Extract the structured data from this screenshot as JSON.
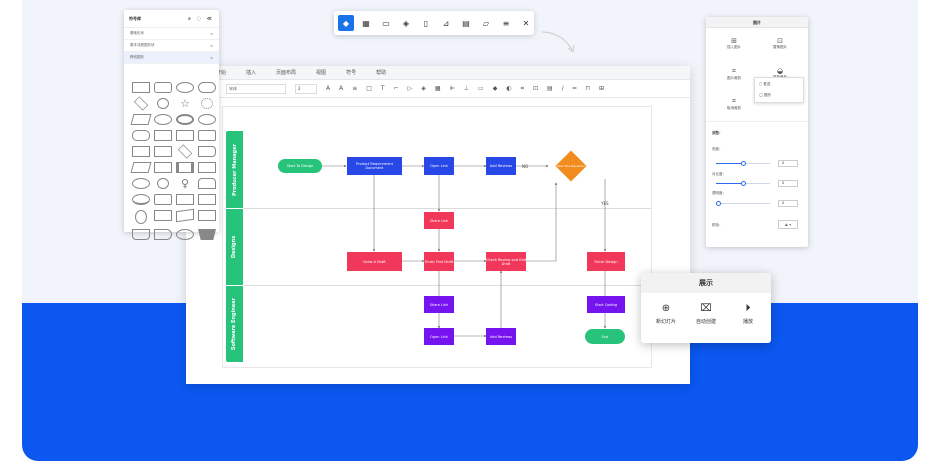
{
  "floating_toolbar": {
    "buttons": [
      "fill-icon",
      "grid-icon",
      "image-icon",
      "layers-icon",
      "page-icon",
      "chart-icon",
      "table-icon",
      "note-icon",
      "list-icon",
      "expand-icon"
    ]
  },
  "shapes_panel": {
    "title": "符号库",
    "libraries": [
      "基础形状",
      "基本流程图形状",
      "跨线图形"
    ],
    "close": "×"
  },
  "editor": {
    "menu": [
      "开始",
      "插入",
      "页面布局",
      "视图",
      "符号",
      "帮助"
    ],
    "font_name": "宋体",
    "font_size": "2"
  },
  "flowchart": {
    "lanes": [
      "Producer Manager",
      "Designs",
      "Software Engineer"
    ],
    "nodes": {
      "start": "Start To Design",
      "product_req": "Product Requirement Document",
      "open_link_1": "Open Link",
      "add_reviews_1": "Add Reviews",
      "pass": "Pass The Reviews?",
      "share_link_1": "Share Link",
      "draw_draft": "Draw A Draft",
      "finish_draft": "Finish First Draft",
      "check_review": "Check Review and Edit Draft",
      "finish_design": "Finish Design",
      "share_link_2": "Share Link",
      "start_coding": "Start Coding",
      "open_link_2": "Open Link",
      "add_reviews_2": "Add Reviews",
      "end": "End"
    },
    "no_label": "NO",
    "yes_label": "YES",
    "colors": {
      "green": "#27c37b",
      "blue": "#2747e6",
      "red": "#f2385a",
      "purple": "#7614f0",
      "orange": "#f28c1e"
    }
  },
  "picture_panel": {
    "title": "图片",
    "buttons": [
      "插入图片",
      "替换图片",
      "图片裁剪",
      "重新著色",
      "取消裁剪"
    ],
    "crop_options": [
      "框选",
      "圆形"
    ],
    "adjust_title": "调整：",
    "brightness": {
      "label": "亮度：",
      "value": "0",
      "level": 0.5
    },
    "contrast": {
      "label": "对比度：",
      "value": "0",
      "level": 0.5
    },
    "transparency": {
      "label": "透明度：",
      "value": "0",
      "level": 0.0
    },
    "color_label": "颜色："
  },
  "display_popup": {
    "title": "展示",
    "items": [
      {
        "label": "新幻灯片",
        "icon": "add-circle-icon"
      },
      {
        "label": "自动创建",
        "icon": "presentation-icon"
      },
      {
        "label": "播放",
        "icon": "play-icon"
      }
    ]
  }
}
